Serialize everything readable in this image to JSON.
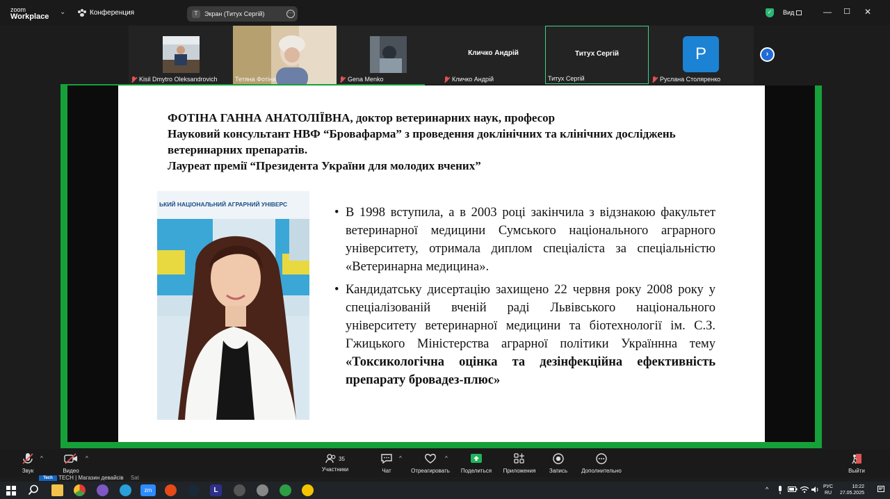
{
  "app": {
    "logo_small": "zoom",
    "logo_name": "Workplace",
    "meeting_menu": "Конференция",
    "screen_share_label": "Экран (Титух Сергій)",
    "screen_share_initial": "Т",
    "view_label": "Вид"
  },
  "participants": [
    {
      "name": "Kisil Dmytro Oleksandrovich",
      "muted": true,
      "video": true
    },
    {
      "name": "Тетяна Фотіна",
      "muted": false,
      "video": true
    },
    {
      "name": "Gena Menko",
      "muted": true,
      "video": true
    },
    {
      "name": "Кличко Андрій",
      "muted": true,
      "video": false,
      "display_name": "Кличко Андрій"
    },
    {
      "name": "Титух Сергій",
      "muted": false,
      "video": false,
      "display_name": "Титух Сергій",
      "active_speaker": true
    },
    {
      "name": "Руслана Столяренко",
      "muted": true,
      "video": false,
      "avatar_letter": "P",
      "avatar_color": "#1b82d4"
    }
  ],
  "slide": {
    "heading_lines": [
      "ФОТІНА ГАННА АНАТОЛІЇВНА, доктор ветеринарних наук, професор",
      "Науковий консультант НВФ “Бровафарма” з проведення доклінічних та клінічних досліджень ветеринарних препаратів.",
      "Лауреат премії “Президента України для молодих вчених”"
    ],
    "photo_banner_text": "ЬКИЙ НАЦІОНАЛЬНИЙ АГРАРНИЙ УНІВЕРС",
    "bullet1": "В 1998 вступила, а в 2003 році закінчила з відзнакою факультет ветеринарної медицини Сумського національного аграрного університету, отримала диплом спеціаліста за спеціальністю «Ветеринарна медицина».",
    "bullet2_plain": "Кандидатську дисертацію захищено 22 червня року 2008 року у спеціалізованій вченій раді Львівського національного  університету ветеринарної медицини та біотехнології ім. С.З. Гжицького Міністерства аграрної політики Україннна тему ",
    "bullet2_bold": "«Токсикологічна оцінка та дезінфекційна ефективність препарату бровадез-плюс»"
  },
  "toolbar": {
    "audio": "Звук",
    "video": "Видео",
    "participants": "Участники",
    "participants_count": "35",
    "chat": "Чат",
    "react": "Отреагировать",
    "share": "Поделиться",
    "apps": "Приложения",
    "record": "Запись",
    "more": "Дополнительно",
    "leave": "Выйти"
  },
  "taskbar": {
    "news_text": "TECH | Магазин девайсів",
    "news_sub": "Sat",
    "lang_top": "РУС",
    "lang_bottom": "RU",
    "time": "10:22",
    "date": "27.05.2025"
  },
  "colors": {
    "share_border": "#16a03a",
    "accent_blue": "#1f6bd8",
    "share_green": "#2bb673",
    "muted_red": "#e05454"
  }
}
